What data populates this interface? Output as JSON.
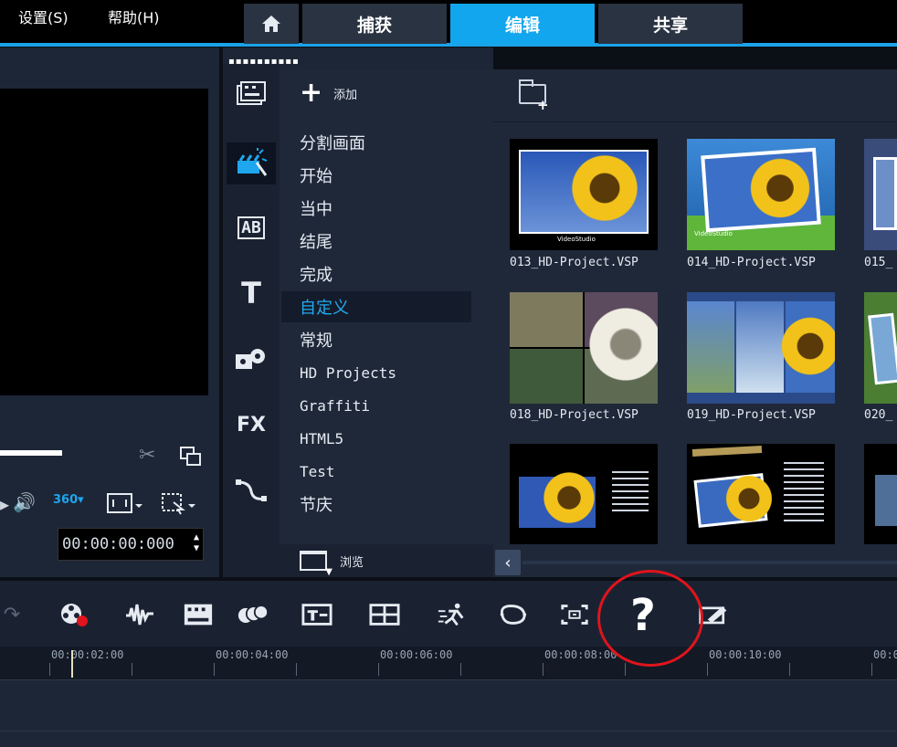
{
  "menu": {
    "settings": "设置(S)",
    "help": "帮助(H)"
  },
  "tabs": {
    "capture": "捕获",
    "edit": "编辑",
    "share": "共享"
  },
  "preview": {
    "timecode": "00:00:00:000"
  },
  "library": {
    "add_label": "添加",
    "categories": [
      "分割画面",
      "开始",
      "当中",
      "结尾",
      "完成",
      "自定义",
      "常规",
      "HD Projects",
      "Graffiti",
      "HTML5",
      "Test",
      "节庆"
    ],
    "selected_category": "自定义",
    "browse_label": "浏览"
  },
  "thumbnails": [
    {
      "label": "013_HD-Project.VSP"
    },
    {
      "label": "014_HD-Project.VSP"
    },
    {
      "label": "015_"
    },
    {
      "label": "018_HD-Project.VSP"
    },
    {
      "label": "019_HD-Project.VSP"
    },
    {
      "label": "020_"
    }
  ],
  "thumb_overlay_texts": {
    "videostudio": "VideoStudio"
  },
  "side_icons": {
    "ab": "AB",
    "title": "T",
    "fx": "FX"
  },
  "timeline": {
    "ticks": [
      "00:00:02:00",
      "00:00:04:00",
      "00:00:06:00",
      "00:00:08:00",
      "00:00:10:00",
      "00:0"
    ]
  },
  "annotation": {
    "mark": "?"
  },
  "colors": {
    "accent": "#12a6ee",
    "highlight_text": "#22a9f0",
    "annotation": "#e0141c"
  }
}
